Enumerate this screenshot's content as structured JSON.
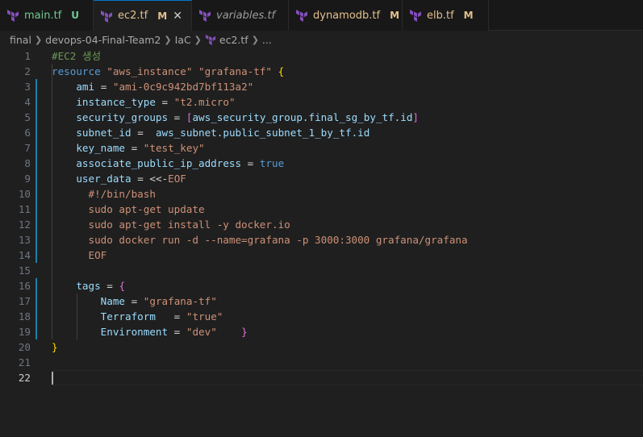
{
  "tabs": [
    {
      "name": "main.tf",
      "badge": "U",
      "state": "untracked",
      "italic": false
    },
    {
      "name": "ec2.tf",
      "badge": "M",
      "state": "active",
      "italic": false
    },
    {
      "name": "variables.tf",
      "badge": "",
      "state": "normal",
      "italic": true
    },
    {
      "name": "dynamodb.tf",
      "badge": "M",
      "state": "mod",
      "italic": false
    },
    {
      "name": "elb.tf",
      "badge": "M",
      "state": "mod",
      "italic": false
    }
  ],
  "breadcrumb": [
    "final",
    "devops-04-Final-Team2",
    "IaC",
    "ec2.tf",
    "..."
  ],
  "colors": {
    "accent": "#0078d4",
    "terraform_icon": "#844fba",
    "modified": "#e2c08d",
    "untracked": "#73c991",
    "git_mark": "#1b81a8"
  },
  "code_lines": [
    "#EC2 생성",
    "resource \"aws_instance\" \"grafana-tf\" {",
    "    ami = \"ami-0c9c942bd7bf113a2\"",
    "    instance_type = \"t2.micro\"",
    "    security_groups = [aws_security_group.final_sg_by_tf.id]",
    "    subnet_id =  aws_subnet.public_subnet_1_by_tf.id",
    "    key_name = \"test_key\"",
    "    associate_public_ip_address = true",
    "    user_data = <<-EOF",
    "      #!/bin/bash",
    "      sudo apt-get update",
    "      sudo apt-get install -y docker.io",
    "      sudo docker run -d --name=grafana -p 3000:3000 grafana/grafana",
    "      EOF",
    "",
    "    tags = {",
    "        Name = \"grafana-tf\"",
    "        Terraform   = \"true\"",
    "        Environment = \"dev\"    }",
    "}",
    "",
    ""
  ],
  "modified_lines": [
    3,
    4,
    5,
    6,
    7,
    8,
    9,
    10,
    11,
    12,
    13,
    14,
    16,
    17,
    18,
    19
  ],
  "current_line": 22
}
